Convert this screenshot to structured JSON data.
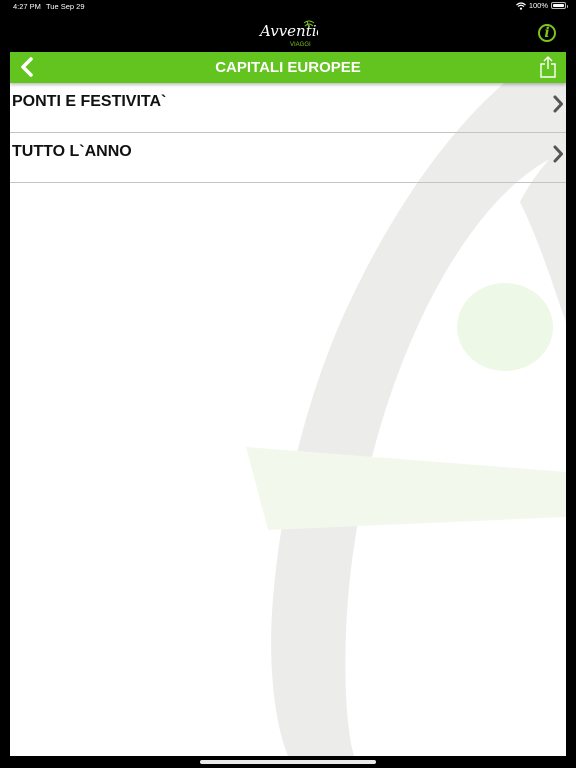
{
  "status_bar": {
    "time": "4:27 PM",
    "date": "Tue Sep 29",
    "battery": "100%"
  },
  "header": {
    "logo_text": "Avventidea",
    "logo_sub": "VIAGGI",
    "info_symbol": "i"
  },
  "navbar": {
    "title": "CAPITALI EUROPEE"
  },
  "list": {
    "items": [
      {
        "label": "PONTI E FESTIVITA`"
      },
      {
        "label": "TUTTO L`ANNO"
      }
    ]
  },
  "colors": {
    "accent": "#63c31f",
    "info": "#7cc41e"
  }
}
